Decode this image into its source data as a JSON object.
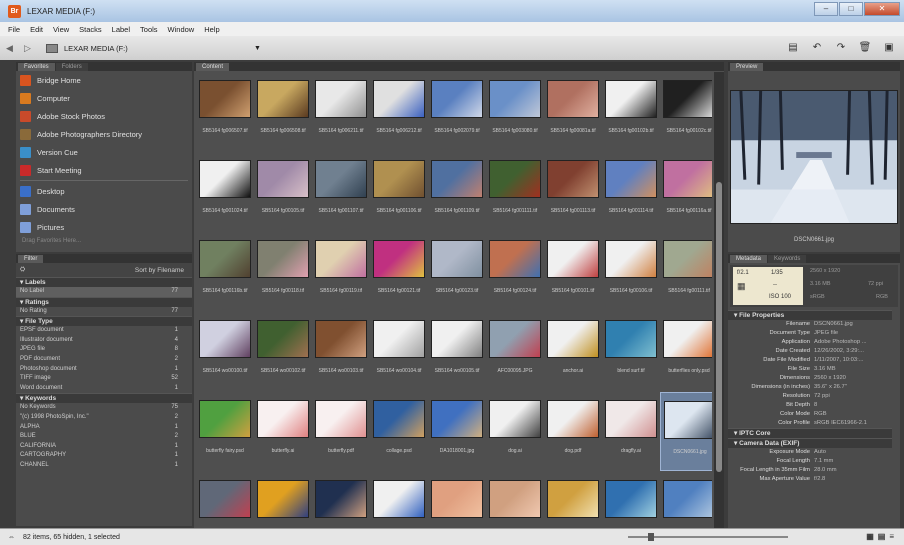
{
  "window": {
    "title": "LEXAR MEDIA (F:)"
  },
  "menu": [
    "File",
    "Edit",
    "View",
    "Stacks",
    "Label",
    "Tools",
    "Window",
    "Help"
  ],
  "path": {
    "location": "LEXAR MEDIA (F:)"
  },
  "favorites": {
    "tabs": [
      "Favorites",
      "Folders"
    ],
    "items": [
      {
        "label": "Bridge Home",
        "color": "#d9541f"
      },
      {
        "label": "Computer",
        "color": "#d97a1f"
      },
      {
        "label": "Adobe Stock Photos",
        "color": "#c94a2a"
      },
      {
        "label": "Adobe Photographers Directory",
        "color": "#8a6a3a"
      },
      {
        "label": "Version Cue",
        "color": "#3a8fc9"
      },
      {
        "label": "Start Meeting",
        "color": "#c92a2a"
      }
    ],
    "places": [
      {
        "label": "Desktop",
        "color": "#3a6fc9"
      },
      {
        "label": "Documents",
        "color": "#7f9fd9"
      },
      {
        "label": "Pictures",
        "color": "#7f9fd9"
      }
    ],
    "hint": "Drag Favorites Here..."
  },
  "filter": {
    "tab": "Filter",
    "sort": "Sort by Filename",
    "sections": [
      {
        "name": "Labels",
        "rows": [
          {
            "label": "No Label",
            "count": "77"
          }
        ]
      },
      {
        "name": "Ratings",
        "rows": [
          {
            "label": "No Rating",
            "count": "77"
          }
        ]
      },
      {
        "name": "File Type",
        "rows": [
          {
            "label": "EPSF document",
            "count": "1"
          },
          {
            "label": "Illustrator document",
            "count": "4"
          },
          {
            "label": "JPEG file",
            "count": "8"
          },
          {
            "label": "PDF document",
            "count": "2"
          },
          {
            "label": "Photoshop document",
            "count": "1"
          },
          {
            "label": "TIFF image",
            "count": "52"
          },
          {
            "label": "Word document",
            "count": "1"
          }
        ]
      },
      {
        "name": "Keywords",
        "rows": [
          {
            "label": "No Keywords",
            "count": "75"
          },
          {
            "label": "\"(c) 1998 PhotoSpin, Inc.\"",
            "count": "2"
          },
          {
            "label": "ALPHA",
            "count": "1"
          },
          {
            "label": "BLUE",
            "count": "2"
          },
          {
            "label": "CALIFORNIA",
            "count": "1"
          },
          {
            "label": "CARTOGRAPHY",
            "count": "1"
          },
          {
            "label": "CHANNEL",
            "count": "1"
          }
        ]
      }
    ]
  },
  "content": {
    "tab": "Content",
    "items": [
      {
        "name": "SB5164 fg006507.tif",
        "c1": "#7a5030",
        "c2": "#d0a070"
      },
      {
        "name": "SB5164 fg006508.tif",
        "c1": "#c8a860",
        "c2": "#5a3a20"
      },
      {
        "name": "SB5164 fg006211.tif",
        "c1": "#e8e8e8",
        "c2": "#909090"
      },
      {
        "name": "SB5164 fg006212.tif",
        "c1": "#e0e0e0",
        "c2": "#3a60c0"
      },
      {
        "name": "SB5164 fg002079.tif",
        "c1": "#5a80c0",
        "c2": "#d0d8e8"
      },
      {
        "name": "SB5164 fg003080.tif",
        "c1": "#6a90c8",
        "c2": "#c0c8d8"
      },
      {
        "name": "SB5164 fg00081a.tif",
        "c1": "#b07060",
        "c2": "#e0b0a0"
      },
      {
        "name": "SB5164 fg00102b.tif",
        "c1": "#f0f0f0",
        "c2": "#202020"
      },
      {
        "name": "SB5164 fg00102c.tif",
        "c1": "#202020",
        "c2": "#e0e0e0"
      },
      {
        "name": "SB5164 fg001024.tif",
        "c1": "#f0f0f0",
        "c2": "#101010"
      },
      {
        "name": "SB5164 fg00105.tif",
        "c1": "#a08aa8",
        "c2": "#d8c0c8"
      },
      {
        "name": "SB5164 fg001107.tif",
        "c1": "#708090",
        "c2": "#304050"
      },
      {
        "name": "SB5164 fg001106.tif",
        "c1": "#b09050",
        "c2": "#705030"
      },
      {
        "name": "SB5164 fg001109.tif",
        "c1": "#5070a0",
        "c2": "#c08070"
      },
      {
        "name": "SB5164 fg001111.tif",
        "c1": "#406030",
        "c2": "#a03020"
      },
      {
        "name": "SB5164 fg001113.tif",
        "c1": "#804030",
        "c2": "#c09070"
      },
      {
        "name": "SB5164 fg001114.tif",
        "c1": "#6080c0",
        "c2": "#d09060"
      },
      {
        "name": "SB5164 fg00116a.tif",
        "c1": "#c070a0",
        "c2": "#e0c080"
      },
      {
        "name": "SB5164 fg00116b.tif",
        "c1": "#708060",
        "c2": "#504030"
      },
      {
        "name": "SB5164 fg00118.tif",
        "c1": "#808070",
        "c2": "#e0a0b0"
      },
      {
        "name": "SB5164 fg00119.tif",
        "c1": "#e0d0b0",
        "c2": "#c070a0"
      },
      {
        "name": "SB5164 fg00121.tif",
        "c1": "#c03080",
        "c2": "#e0c040"
      },
      {
        "name": "SB5164 fg00123.tif",
        "c1": "#b0b8c8",
        "c2": "#8090a0"
      },
      {
        "name": "SB5164 fg00124.tif",
        "c1": "#c07050",
        "c2": "#4070b0"
      },
      {
        "name": "SB5164 fg00101.tif",
        "c1": "#f0f0f0",
        "c2": "#c04040"
      },
      {
        "name": "SB5164 fg00106.tif",
        "c1": "#f0f0f0",
        "c2": "#d08040"
      },
      {
        "name": "SB5164 fg00111.tif",
        "c1": "#a0a890",
        "c2": "#c08060"
      },
      {
        "name": "SB5164 wo00100.tif",
        "c1": "#d0d0e0",
        "c2": "#604060"
      },
      {
        "name": "SB5164 wo00102.tif",
        "c1": "#406030",
        "c2": "#a07050"
      },
      {
        "name": "SB5164 wo00103.tif",
        "c1": "#805030",
        "c2": "#d0a080"
      },
      {
        "name": "SB5164 wo00104.tif",
        "c1": "#f0f0f0",
        "c2": "#a0a0a0"
      },
      {
        "name": "SB5164 wo00105.tif",
        "c1": "#f0f0f0",
        "c2": "#808080"
      },
      {
        "name": "AFC00095.JPG",
        "c1": "#90a0b0",
        "c2": "#c04050"
      },
      {
        "name": "anchor.ai",
        "c1": "#f0f0f0",
        "c2": "#c09020"
      },
      {
        "name": "blend surf.tif",
        "c1": "#3080b0",
        "c2": "#80c0d0"
      },
      {
        "name": "butterflies only.psd",
        "c1": "#f0f0f0",
        "c2": "#e07030"
      },
      {
        "name": "butterfly fairy.psd",
        "c1": "#50a040",
        "c2": "#d0a040"
      },
      {
        "name": "butterfly.ai",
        "c1": "#f8f0f0",
        "c2": "#e08080"
      },
      {
        "name": "butterfly.pdf",
        "c1": "#f8f0f0",
        "c2": "#e09090"
      },
      {
        "name": "collage.psd",
        "c1": "#3060a0",
        "c2": "#d0a060"
      },
      {
        "name": "DA1018001.jpg",
        "c1": "#4070c0",
        "c2": "#d0b080"
      },
      {
        "name": "dog.ai",
        "c1": "#f0f0f0",
        "c2": "#404040"
      },
      {
        "name": "dog.pdf",
        "c1": "#f0f0f0",
        "c2": "#c06030"
      },
      {
        "name": "dragfly.ai",
        "c1": "#f0e8e8",
        "c2": "#d09090"
      },
      {
        "name": "DSCN0661.jpg",
        "c1": "#dde6f0",
        "c2": "#3a4a60"
      },
      {
        "name": "",
        "c1": "#606878",
        "c2": "#c04050"
      },
      {
        "name": "",
        "c1": "#e0a020",
        "c2": "#304080"
      },
      {
        "name": "",
        "c1": "#203050",
        "c2": "#d0a080"
      },
      {
        "name": "",
        "c1": "#f0f0f0",
        "c2": "#3060c0"
      },
      {
        "name": "",
        "c1": "#e0a080",
        "c2": "#f0c0a0"
      },
      {
        "name": "",
        "c1": "#d0a080",
        "c2": "#f0c8b0"
      },
      {
        "name": "",
        "c1": "#d0a040",
        "c2": "#f0e0b0"
      },
      {
        "name": "",
        "c1": "#3070b0",
        "c2": "#a0d0e0"
      },
      {
        "name": "",
        "c1": "#5080c0",
        "c2": "#b0c8e0"
      }
    ],
    "selected_index": 44
  },
  "preview": {
    "tab": "Preview",
    "filename": "DSCN0661.jpg"
  },
  "metadata": {
    "tabs": [
      "Metadata",
      "Keywords"
    ],
    "summary": {
      "aperture": "f/2.1",
      "shutter": "1/35",
      "ev": "--",
      "iso": "ISO 100",
      "dims": "2560 x 1920",
      "size": "3.16 MB",
      "ppi": "72 ppi",
      "colorspace": "sRGB",
      "mode": "RGB"
    },
    "sections": [
      {
        "name": "File Properties",
        "rows": [
          {
            "k": "Filename",
            "v": "DSCN0661.jpg"
          },
          {
            "k": "Document Type",
            "v": "JPEG file"
          },
          {
            "k": "Application",
            "v": "Adobe Photoshop ..."
          },
          {
            "k": "Date Created",
            "v": "12/26/2002, 3:29:..."
          },
          {
            "k": "Date File Modified",
            "v": "1/11/2007, 10:03:..."
          },
          {
            "k": "File Size",
            "v": "3.16 MB"
          },
          {
            "k": "Dimensions",
            "v": "2560 x 1920"
          },
          {
            "k": "Dimensions (in inches)",
            "v": "35.6\" x 26.7\""
          },
          {
            "k": "Resolution",
            "v": "72 ppi"
          },
          {
            "k": "Bit Depth",
            "v": "8"
          },
          {
            "k": "Color Mode",
            "v": "RGB"
          },
          {
            "k": "Color Profile",
            "v": "sRGB IEC61966-2.1"
          }
        ]
      },
      {
        "name": "IPTC Core",
        "rows": []
      },
      {
        "name": "Camera Data (EXIF)",
        "rows": [
          {
            "k": "Exposure Mode",
            "v": "Auto"
          },
          {
            "k": "Focal Length",
            "v": "7.1 mm"
          },
          {
            "k": "Focal Length in 35mm Film",
            "v": "28.0 mm"
          },
          {
            "k": "Max Aperture Value",
            "v": "f/2.8"
          }
        ]
      }
    ]
  },
  "status": {
    "text": "82 items, 65 hidden, 1 selected"
  }
}
